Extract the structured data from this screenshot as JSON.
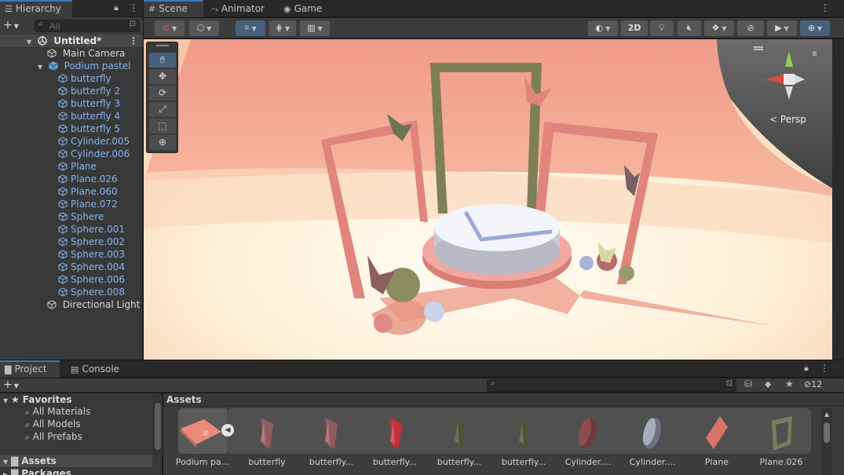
{
  "hierarchy": {
    "tab_label": "Hierarchy",
    "search_placeholder": "All",
    "scene_name": "Untitled*",
    "items": [
      {
        "label": "Main Camera"
      },
      {
        "label": "Podium pastel"
      },
      {
        "label": "butterfly"
      },
      {
        "label": "butterfly 2"
      },
      {
        "label": "butterfly 3"
      },
      {
        "label": "butterfly 4"
      },
      {
        "label": "butterfly 5"
      },
      {
        "label": "Cylinder.005"
      },
      {
        "label": "Cylinder.006"
      },
      {
        "label": "Plane"
      },
      {
        "label": "Plane.026"
      },
      {
        "label": "Plane.060"
      },
      {
        "label": "Plane.072"
      },
      {
        "label": "Sphere"
      },
      {
        "label": "Sphere.001"
      },
      {
        "label": "Sphere.002"
      },
      {
        "label": "Sphere.003"
      },
      {
        "label": "Sphere.004"
      },
      {
        "label": "Sphere.006"
      },
      {
        "label": "Sphere.008"
      },
      {
        "label": "Directional Light"
      }
    ]
  },
  "scene": {
    "tabs": [
      {
        "label": "Scene"
      },
      {
        "label": "Animator"
      },
      {
        "label": "Game"
      }
    ],
    "toolbar": {
      "mode_2d": "2D"
    },
    "persp_label": "Persp",
    "colors": {
      "sky": "#f2a593",
      "floor": "#fbe9c9",
      "accent": "#3a79bb"
    }
  },
  "project": {
    "tabs": [
      {
        "label": "Project"
      },
      {
        "label": "Console"
      }
    ],
    "hidden_count": "12",
    "tree": {
      "favorites": "Favorites",
      "fav_items": [
        "All Materials",
        "All Models",
        "All Prefabs"
      ],
      "assets": "Assets",
      "packages": "Packages"
    },
    "assets_header": "Assets",
    "assets": [
      {
        "label": "Podium pa..."
      },
      {
        "label": "butterfly"
      },
      {
        "label": "butterfly..."
      },
      {
        "label": "butterfly..."
      },
      {
        "label": "butterfly..."
      },
      {
        "label": "butterfly..."
      },
      {
        "label": "Cylinder...."
      },
      {
        "label": "Cylinder...."
      },
      {
        "label": "Plane"
      },
      {
        "label": "Plane.026"
      }
    ]
  }
}
